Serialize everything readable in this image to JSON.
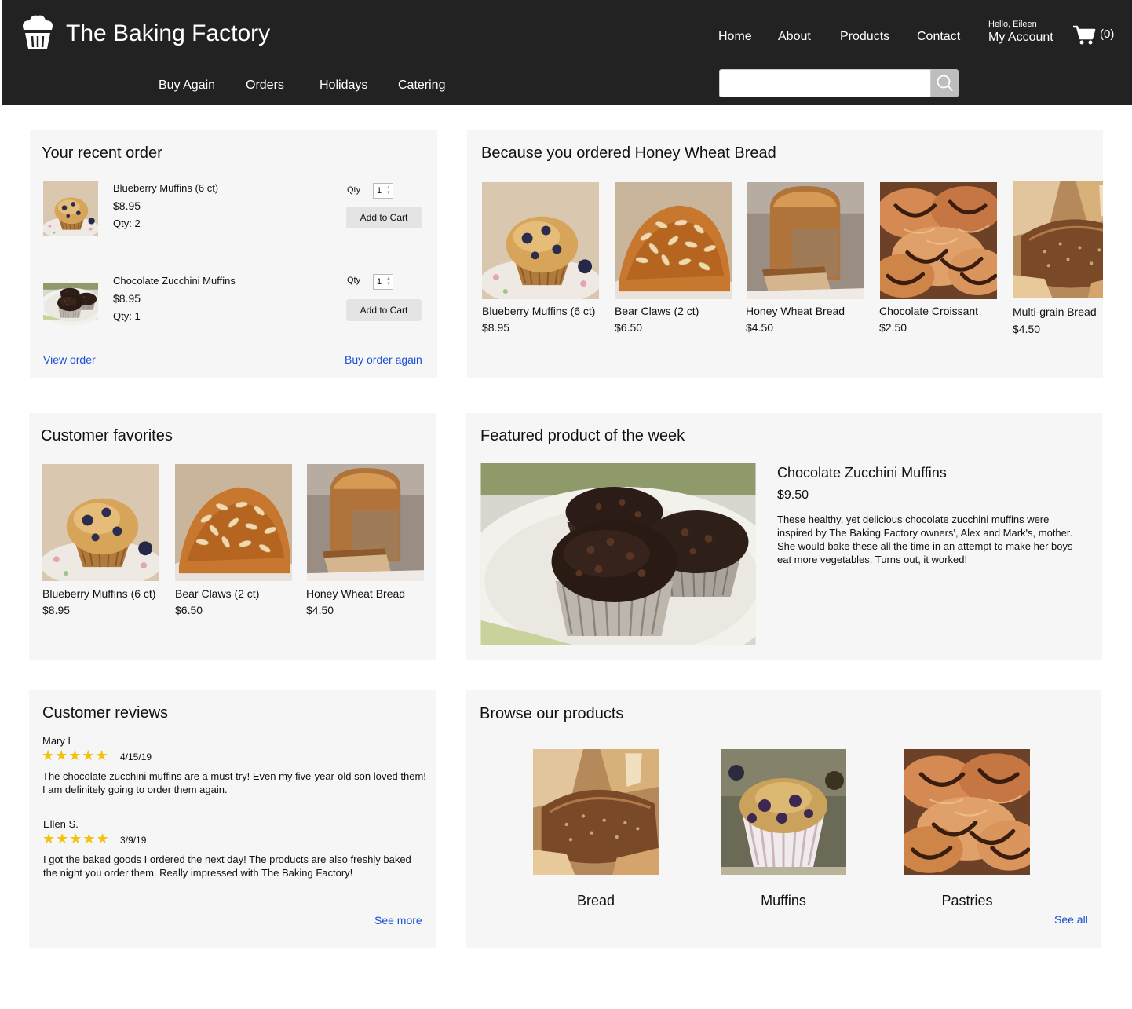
{
  "header": {
    "brand": "The Baking Factory",
    "nav": [
      "Home",
      "About",
      "Products",
      "Contact"
    ],
    "greeting": "Hello, Eileen",
    "account": "My Account",
    "cart_count": "(0)",
    "subnav": [
      "Buy Again",
      "Orders",
      "Holidays",
      "Catering"
    ],
    "search_placeholder": ""
  },
  "recent_order": {
    "title": "Your recent order",
    "items": [
      {
        "name": "Blueberry Muffins (6 ct)",
        "price": "$8.95",
        "qty": "Qty: 2",
        "qty_label": "Qty",
        "qty_value": "1",
        "button": "Add to Cart"
      },
      {
        "name": "Chocolate Zucchini Muffins",
        "price": "$8.95",
        "qty": "Qty: 1",
        "qty_label": "Qty",
        "qty_value": "1",
        "button": "Add to Cart"
      }
    ],
    "view_order": "View order",
    "buy_again": "Buy order again"
  },
  "because": {
    "title": "Because you ordered Honey Wheat Bread",
    "products": [
      {
        "name": "Blueberry Muffins (6 ct)",
        "price": "$8.95"
      },
      {
        "name": "Bear Claws (2 ct)",
        "price": "$6.50"
      },
      {
        "name": "Honey Wheat Bread",
        "price": "$4.50"
      },
      {
        "name": "Chocolate Croissant",
        "price": "$2.50"
      },
      {
        "name": "Multi-grain Bread",
        "price": "$4.50"
      }
    ]
  },
  "favorites": {
    "title": "Customer favorites",
    "products": [
      {
        "name": "Blueberry Muffins (6 ct)",
        "price": "$8.95"
      },
      {
        "name": "Bear Claws (2 ct)",
        "price": "$6.50"
      },
      {
        "name": "Honey Wheat Bread",
        "price": "$4.50"
      }
    ]
  },
  "featured": {
    "title": "Featured product of the week",
    "name": "Chocolate Zucchini Muffins",
    "price": "$9.50",
    "description": "These healthy, yet delicious chocolate zucchini muffins were inspired by The Baking Factory owners', Alex and Mark's, mother. She would bake these all the time in an attempt to make her boys eat more vegetables. Turns out, it worked!"
  },
  "reviews": {
    "title": "Customer reviews",
    "items": [
      {
        "author": "Mary L.",
        "stars": "★★★★★",
        "rating": 5,
        "date": "4/15/19",
        "text": "The chocolate zucchini muffins are a must try! Even my five-year-old son loved them! I am definitely going to order them again."
      },
      {
        "author": "Ellen S.",
        "stars": "★★★★★",
        "rating": 5,
        "date": "3/9/19",
        "text": "I got the baked goods I ordered the next day! The products are also freshly baked the night you order them. Really impressed with The Baking Factory!"
      }
    ],
    "see_more": "See more"
  },
  "browse": {
    "title": "Browse our products",
    "categories": [
      "Bread",
      "Muffins",
      "Pastries"
    ],
    "see_all": "See all"
  },
  "colors": {
    "header_bg": "#222222",
    "panel_bg": "#f6f6f6",
    "link": "#1a4fd6",
    "star": "#f4c20d"
  }
}
